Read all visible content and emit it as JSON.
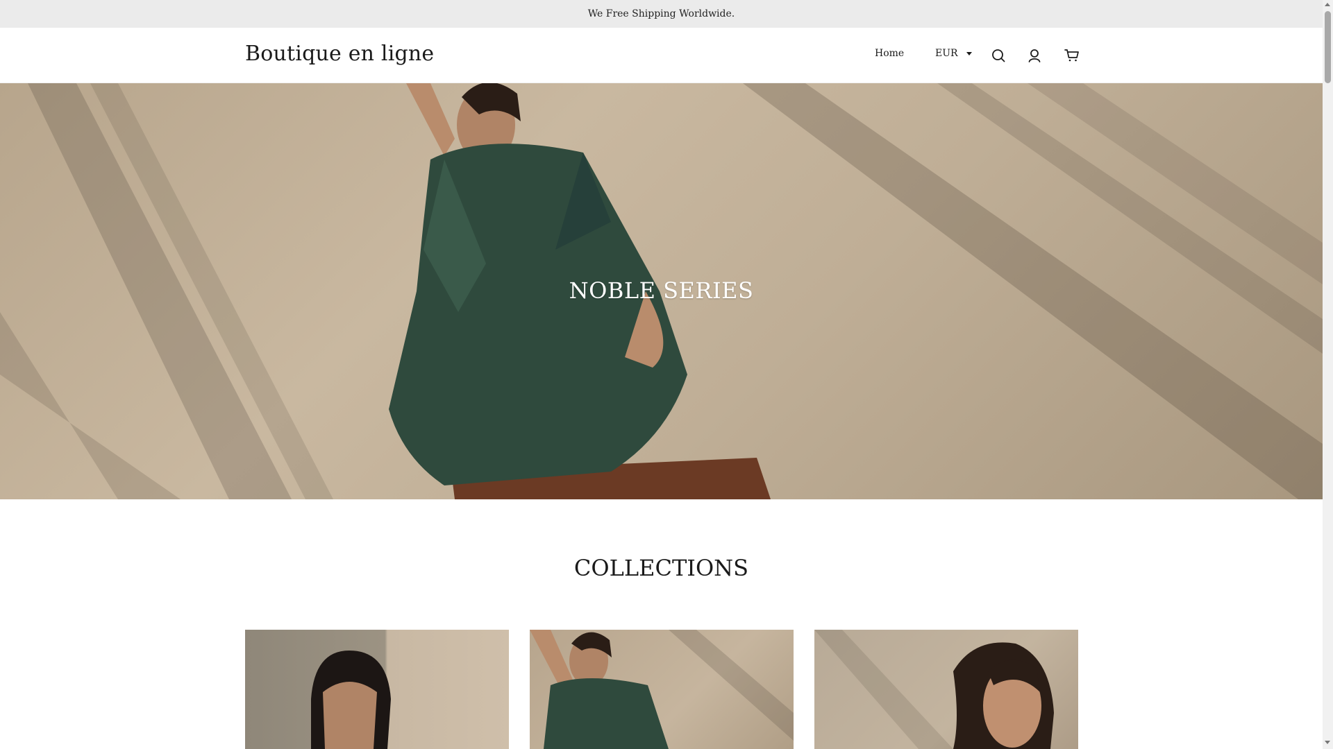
{
  "announcement": {
    "text": "We Free Shipping Worldwide."
  },
  "header": {
    "logo": "Boutique en ligne",
    "nav": {
      "home": "Home"
    },
    "currency": {
      "selected": "EUR"
    },
    "icons": {
      "search": "search-icon",
      "account": "account-icon",
      "cart": "cart-icon"
    }
  },
  "hero": {
    "title": "NOBLE SERIES"
  },
  "collections": {
    "title": "COLLECTIONS",
    "cards": [
      {
        "image": "collection-image-1"
      },
      {
        "image": "collection-image-2"
      },
      {
        "image": "collection-image-3"
      }
    ]
  },
  "colors": {
    "announcement_bg": "#ebebeb",
    "hero_wall": "#c9b8a0",
    "garment_green": "#2f4a3d",
    "text": "#1a1a1a"
  }
}
